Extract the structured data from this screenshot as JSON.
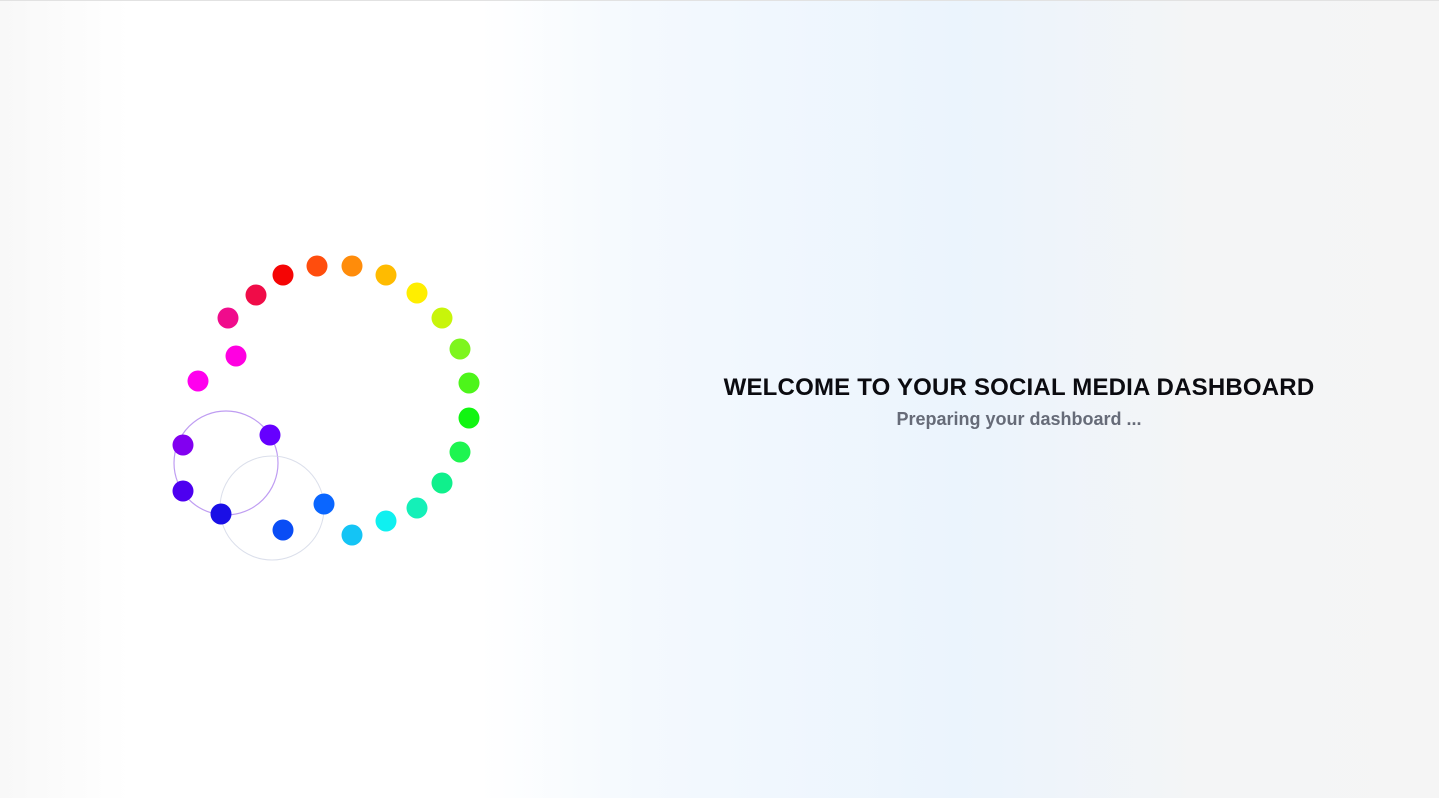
{
  "welcome": {
    "title": "WELCOME TO YOUR SOCIAL MEDIA DASHBOARD",
    "subtitle": "Preparing your dashboard ..."
  },
  "loader": {
    "dot_colors": [
      "#ff00ee",
      "#ff00e1",
      "#f00c8c",
      "#f00c48",
      "#f50505",
      "#ff4d0d",
      "#ff8c0a",
      "#ffbb00",
      "#ffee00",
      "#c8f50a",
      "#7ef51e",
      "#4df51a",
      "#11f511",
      "#1ef550",
      "#0ff08c",
      "#14f0b8",
      "#0ff0f0",
      "#14c4f5",
      "#0a66ff",
      "#0a4df5",
      "#1a0fe6",
      "#4d00f0",
      "#8200f0",
      "#6600ff"
    ],
    "orbit_colors": {
      "ring_one": "#b48cf0",
      "ring_two": "#d2d7e6"
    }
  }
}
